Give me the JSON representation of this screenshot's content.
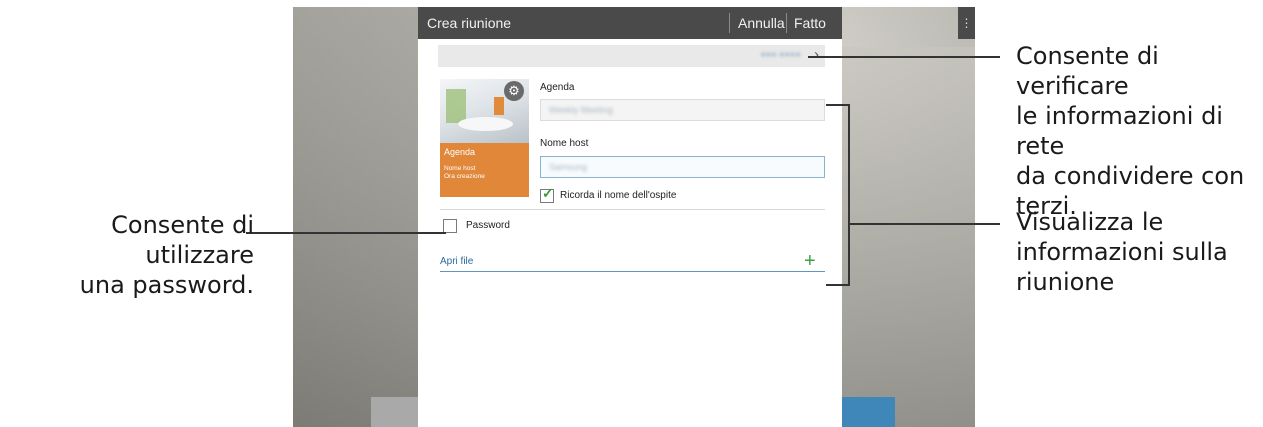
{
  "dialog": {
    "title": "Crea riunione",
    "cancel_label": "Annulla",
    "done_label": "Fatto",
    "overflow_glyph": "⋮",
    "network_info_text": "●●● ●●●●",
    "thumbnail": {
      "agenda_label": "Agenda",
      "host_label": "Nome host",
      "created_label": "Ora creazione"
    },
    "agenda": {
      "label": "Agenda",
      "value": "Weekly Meeting"
    },
    "host": {
      "label": "Nome host",
      "value": "Samsung"
    },
    "remember_guest": {
      "label": "Ricorda il nome dell'ospite",
      "checked": true
    },
    "password": {
      "label": "Password",
      "checked": false
    },
    "open_file": {
      "label": "Apri file"
    }
  },
  "callouts": {
    "network": "Consente di verificare le informazioni di rete da condividere con terzi.",
    "network_lines": [
      "Consente di verificare",
      "le informazioni di rete",
      "da condividere con",
      "terzi."
    ],
    "password_lines": [
      "Consente di utilizzare",
      "una password."
    ],
    "info_lines": [
      "Visualizza le",
      "informazioni sulla",
      "riunione"
    ]
  },
  "colors": {
    "topbar": "#4a4a4a",
    "thumbnail_card": "#e0873a",
    "check_green": "#3a9a3a",
    "link_blue": "#2a6a9a",
    "plus_green": "#3aa34a"
  },
  "icons": [
    "gear-icon",
    "chevron-right-icon",
    "checkmark-icon",
    "plus-icon",
    "overflow-menu-icon"
  ]
}
